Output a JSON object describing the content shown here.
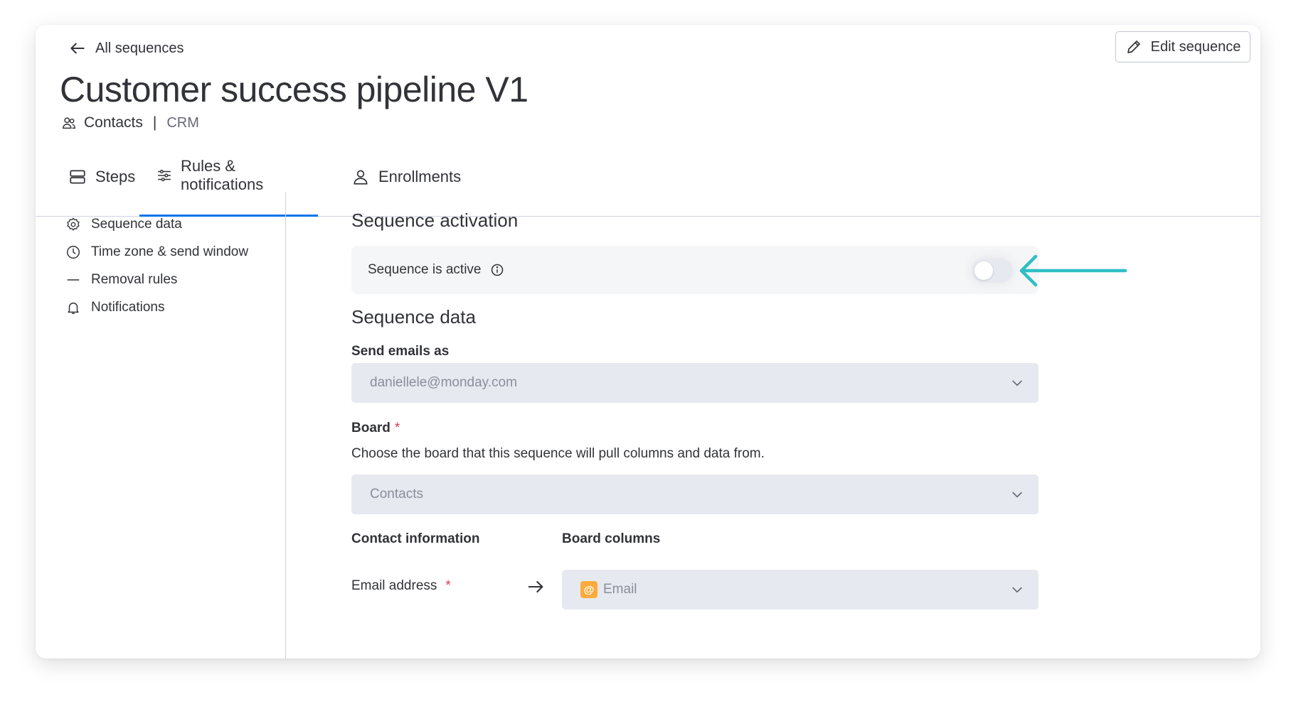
{
  "header": {
    "back_label": "All sequences",
    "edit_label": "Edit sequence",
    "title": "Customer success pipeline V1",
    "board_name": "Contacts",
    "separator": "|",
    "product": "CRM"
  },
  "tabs": [
    {
      "label": "Steps",
      "icon": "rows-icon",
      "active": false
    },
    {
      "label": "Rules & notifications",
      "icon": "sliders-icon",
      "active": true
    },
    {
      "label": "Enrollments",
      "icon": "person-icon",
      "active": false
    }
  ],
  "sidebar": {
    "items": [
      {
        "label": "Sequence data",
        "icon": "gear-icon"
      },
      {
        "label": "Time zone & send window",
        "icon": "clock-icon"
      },
      {
        "label": "Removal rules",
        "icon": "dash-icon"
      },
      {
        "label": "Notifications",
        "icon": "bell-icon"
      }
    ]
  },
  "activation": {
    "section_title": "Sequence activation",
    "label": "Sequence is active",
    "toggle_on": false
  },
  "sequence_data": {
    "section_title": "Sequence data",
    "send_as_label": "Send emails as",
    "send_as_value": "daniellele@monday.com",
    "board_label": "Board",
    "board_required": "*",
    "board_helper": "Choose the board that this sequence will pull columns and data from.",
    "board_value": "Contacts",
    "contact_info_header": "Contact information",
    "board_columns_header": "Board columns",
    "email_row_label": "Email address",
    "email_row_required": "*",
    "email_column_value": "Email",
    "email_chip_glyph": "@"
  },
  "colors": {
    "accent": "#0073ea",
    "annotation_arrow": "#2ebfc4",
    "required": "#d83a52",
    "email_chip": "#fdab3d"
  }
}
